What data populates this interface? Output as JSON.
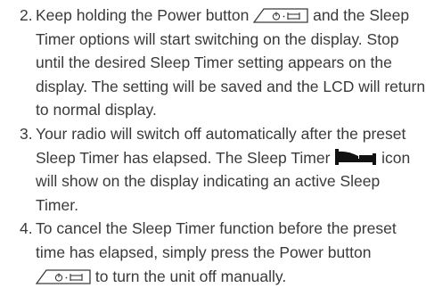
{
  "steps": [
    {
      "number": "2.",
      "part1": "Keep holding the Power button",
      "part2": "and the Sleep Timer options will start switching on the display. Stop until the desired Sleep Timer setting appears on the display. The setting will be saved and the LCD will return to normal display."
    },
    {
      "number": "3.",
      "part1": "Your radio will switch off automatically after the preset Sleep Timer has elapsed. The Sleep Timer",
      "part2": "icon will show on the display indicating an active Sleep Timer."
    },
    {
      "number": "4.",
      "part1": "To cancel the Sleep Timer function before the preset time has elapsed, simply press the Power button",
      "part2": "to turn the unit off manually."
    }
  ],
  "icons": {
    "power_button": "power-button-icon",
    "sleep_timer": "sleep-timer-icon"
  }
}
